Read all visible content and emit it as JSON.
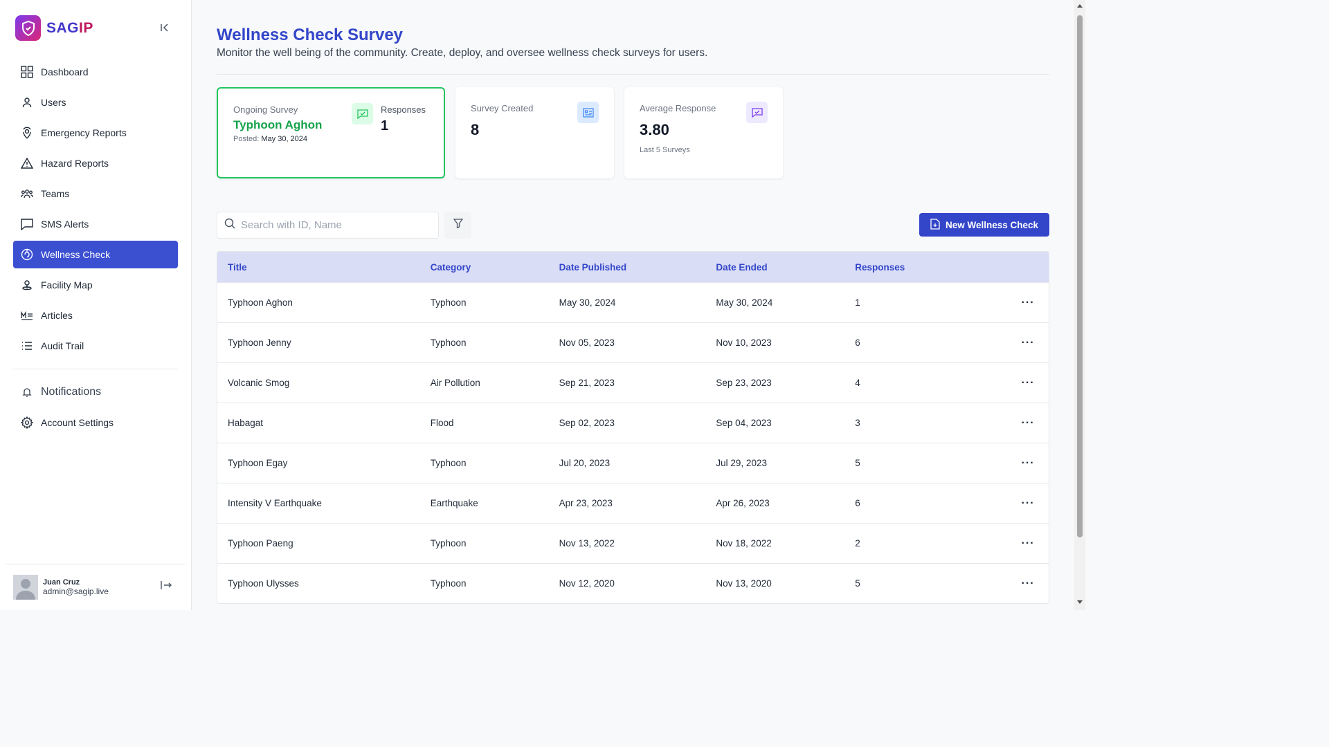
{
  "brand": {
    "name_a": "SAG",
    "name_b": "IP"
  },
  "nav": [
    {
      "label": "Dashboard",
      "icon": "dashboard-icon"
    },
    {
      "label": "Users",
      "icon": "user-icon"
    },
    {
      "label": "Emergency Reports",
      "icon": "location-pin-icon"
    },
    {
      "label": "Hazard Reports",
      "icon": "warning-icon"
    },
    {
      "label": "Teams",
      "icon": "team-icon"
    },
    {
      "label": "SMS Alerts",
      "icon": "message-icon"
    },
    {
      "label": "Wellness Check",
      "icon": "wellness-icon",
      "active": true
    },
    {
      "label": "Facility Map",
      "icon": "map-pin-icon"
    },
    {
      "label": "Articles",
      "icon": "articles-icon"
    },
    {
      "label": "Audit Trail",
      "icon": "list-icon"
    }
  ],
  "nav_bottom": {
    "notifications": "Notifications",
    "account_settings": "Account Settings"
  },
  "user": {
    "name": "Juan Cruz",
    "email": "admin@sagip.live"
  },
  "page": {
    "title": "Wellness Check Survey",
    "subtitle": "Monitor the well being of the community. Create, deploy, and oversee wellness check surveys for users."
  },
  "cards": {
    "ongoing": {
      "label": "Ongoing Survey",
      "name": "Typhoon Aghon",
      "posted_label": "Posted:",
      "posted_date": "May 30, 2024",
      "responses_label": "Responses",
      "responses": "1"
    },
    "created": {
      "label": "Survey Created",
      "value": "8"
    },
    "average": {
      "label": "Average Response",
      "value": "3.80",
      "note": "Last 5 Surveys"
    }
  },
  "search": {
    "placeholder": "Search with ID, Name",
    "value": ""
  },
  "new_button": "New Wellness Check",
  "table": {
    "headers": {
      "title": "Title",
      "category": "Category",
      "published": "Date Published",
      "ended": "Date Ended",
      "responses": "Responses"
    },
    "more": "···",
    "rows": [
      {
        "title": "Typhoon Aghon",
        "category": "Typhoon",
        "published": "May 30, 2024",
        "ended": "May 30, 2024",
        "responses": "1"
      },
      {
        "title": "Typhoon Jenny",
        "category": "Typhoon",
        "published": "Nov 05, 2023",
        "ended": "Nov 10, 2023",
        "responses": "6"
      },
      {
        "title": "Volcanic Smog",
        "category": "Air Pollution",
        "published": "Sep 21, 2023",
        "ended": "Sep 23, 2023",
        "responses": "4"
      },
      {
        "title": "Habagat",
        "category": "Flood",
        "published": "Sep 02, 2023",
        "ended": "Sep 04, 2023",
        "responses": "3"
      },
      {
        "title": "Typhoon Egay",
        "category": "Typhoon",
        "published": "Jul 20, 2023",
        "ended": "Jul 29, 2023",
        "responses": "5"
      },
      {
        "title": "Intensity V Earthquake",
        "category": "Earthquake",
        "published": "Apr 23, 2023",
        "ended": "Apr 26, 2023",
        "responses": "6"
      },
      {
        "title": "Typhoon Paeng",
        "category": "Typhoon",
        "published": "Nov 13, 2022",
        "ended": "Nov 18, 2022",
        "responses": "2"
      },
      {
        "title": "Typhoon Ulysses",
        "category": "Typhoon",
        "published": "Nov 12, 2020",
        "ended": "Nov 13, 2020",
        "responses": "5"
      }
    ]
  },
  "colors": {
    "primary": "#3346c9",
    "success": "#16a34a",
    "header_bg": "#d9ddf6"
  }
}
